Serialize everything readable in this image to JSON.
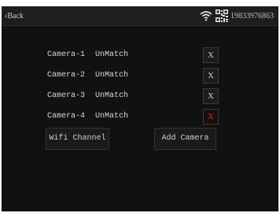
{
  "header": {
    "back_label": "Back",
    "wifi_icon": "wifi-icon",
    "qr_icon": "qr-code-icon",
    "device_id": "19833976863"
  },
  "cameras": [
    {
      "name": "Camera-1",
      "status": "UnMatch",
      "remove": "X"
    },
    {
      "name": "Camera-2",
      "status": "UnMatch",
      "remove": "X"
    },
    {
      "name": "Camera-3",
      "status": "UnMatch",
      "remove": "X"
    },
    {
      "name": "Camera-4",
      "status": "UnMatch",
      "remove": "X"
    }
  ],
  "actions": {
    "wifi_channel": "Wifi Channel",
    "add_camera": "Add Camera"
  },
  "colors": {
    "background": "#111111",
    "topbar": "#1e1e1e",
    "text": "#d8d8d8",
    "active_remove": "#d22a2a"
  }
}
